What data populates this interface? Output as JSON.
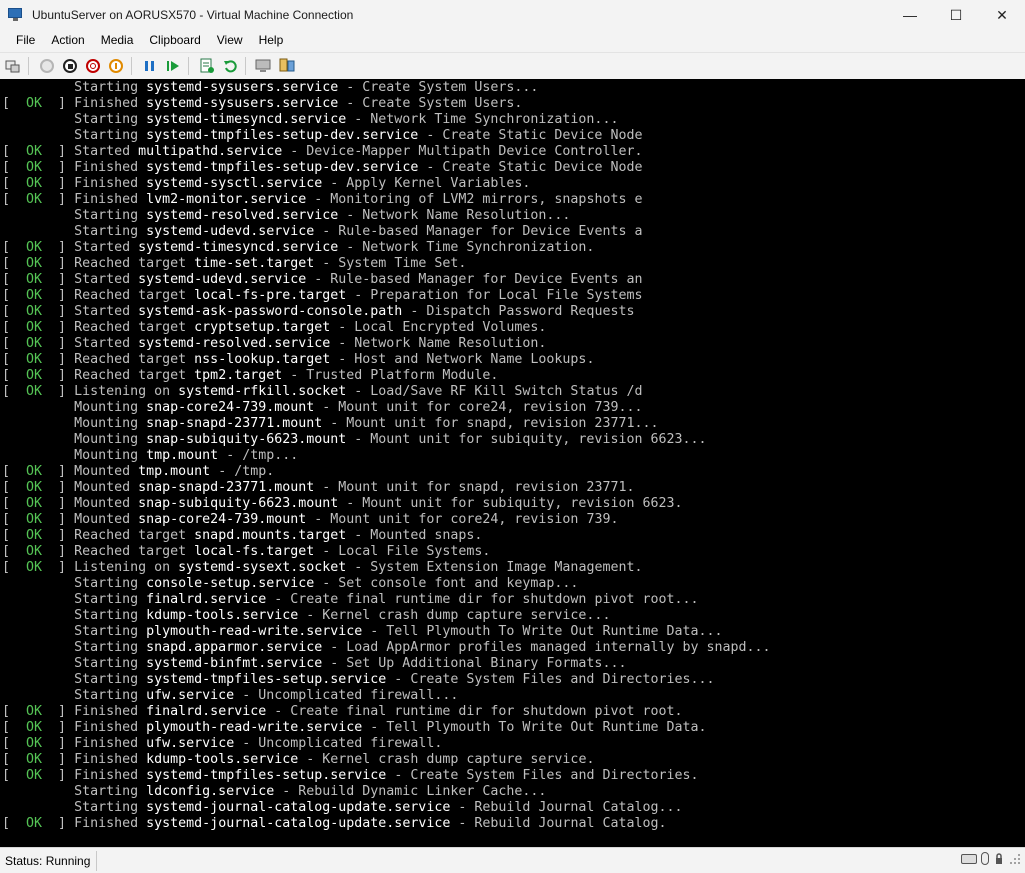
{
  "window": {
    "title": "UbuntuServer on AORUSX570 - Virtual Machine Connection",
    "minimize": "—",
    "maximize": "☐",
    "close": "✕"
  },
  "menu": [
    "File",
    "Action",
    "Media",
    "Clipboard",
    "View",
    "Help"
  ],
  "toolbar_icons": [
    "ctrl-alt-del-icon",
    "start-icon",
    "turn-off-icon",
    "shut-down-icon",
    "save-icon",
    "pause-icon",
    "resume-icon",
    "checkpoint-icon",
    "revert-icon",
    "enhanced-session-icon",
    "share-icon"
  ],
  "status": {
    "text": "Status: Running"
  },
  "console_lines": [
    {
      "ok": false,
      "verb": "Starting",
      "unit": "systemd-sysusers.service",
      "desc": " - Create System Users..."
    },
    {
      "ok": true,
      "verb": "Finished",
      "unit": "systemd-sysusers.service",
      "desc": " - Create System Users."
    },
    {
      "ok": false,
      "verb": "Starting",
      "unit": "systemd-timesyncd.service",
      "desc": " - Network Time Synchronization..."
    },
    {
      "ok": false,
      "verb": "Starting",
      "unit": "systemd-tmpfiles-setup-dev.service",
      "desc": " - Create Static Device Node"
    },
    {
      "ok": true,
      "verb": "Started",
      "unit": "multipathd.service",
      "desc": " - Device-Mapper Multipath Device Controller."
    },
    {
      "ok": true,
      "verb": "Finished",
      "unit": "systemd-tmpfiles-setup-dev.service",
      "desc": " - Create Static Device Node"
    },
    {
      "ok": true,
      "verb": "Finished",
      "unit": "systemd-sysctl.service",
      "desc": " - Apply Kernel Variables."
    },
    {
      "ok": true,
      "verb": "Finished",
      "unit": "lvm2-monitor.service",
      "desc": " - Monitoring of LVM2 mirrors, snapshots e"
    },
    {
      "ok": false,
      "verb": "Starting",
      "unit": "systemd-resolved.service",
      "desc": " - Network Name Resolution..."
    },
    {
      "ok": false,
      "verb": "Starting",
      "unit": "systemd-udevd.service",
      "desc": " - Rule-based Manager for Device Events a"
    },
    {
      "ok": true,
      "verb": "Started",
      "unit": "systemd-timesyncd.service",
      "desc": " - Network Time Synchronization."
    },
    {
      "ok": true,
      "verb": "Reached target",
      "unit": "time-set.target",
      "desc": " - System Time Set."
    },
    {
      "ok": true,
      "verb": "Started",
      "unit": "systemd-udevd.service",
      "desc": " - Rule-based Manager for Device Events an"
    },
    {
      "ok": true,
      "verb": "Reached target",
      "unit": "local-fs-pre.target",
      "desc": " - Preparation for Local File Systems"
    },
    {
      "ok": true,
      "verb": "Started",
      "unit": "systemd-ask-password-console.path",
      "desc": " - Dispatch Password Requests"
    },
    {
      "ok": true,
      "verb": "Reached target",
      "unit": "cryptsetup.target",
      "desc": " - Local Encrypted Volumes."
    },
    {
      "ok": true,
      "verb": "Started",
      "unit": "systemd-resolved.service",
      "desc": " - Network Name Resolution."
    },
    {
      "ok": true,
      "verb": "Reached target",
      "unit": "nss-lookup.target",
      "desc": " - Host and Network Name Lookups."
    },
    {
      "ok": true,
      "verb": "Reached target",
      "unit": "tpm2.target",
      "desc": " - Trusted Platform Module."
    },
    {
      "ok": true,
      "verb": "Listening on",
      "unit": "systemd-rfkill.socket",
      "desc": " - Load/Save RF Kill Switch Status /d"
    },
    {
      "ok": false,
      "verb": "Mounting",
      "unit": "snap-core24-739.mount",
      "desc": " - Mount unit for core24, revision 739..."
    },
    {
      "ok": false,
      "verb": "Mounting",
      "unit": "snap-snapd-23771.mount",
      "desc": " - Mount unit for snapd, revision 23771..."
    },
    {
      "ok": false,
      "verb": "Mounting",
      "unit": "snap-subiquity-6623.mount",
      "desc": " - Mount unit for subiquity, revision 6623..."
    },
    {
      "ok": false,
      "verb": "Mounting",
      "unit": "tmp.mount",
      "desc": " - /tmp..."
    },
    {
      "ok": true,
      "verb": "Mounted",
      "unit": "tmp.mount",
      "desc": " - /tmp."
    },
    {
      "ok": true,
      "verb": "Mounted",
      "unit": "snap-snapd-23771.mount",
      "desc": " - Mount unit for snapd, revision 23771."
    },
    {
      "ok": true,
      "verb": "Mounted",
      "unit": "snap-subiquity-6623.mount",
      "desc": " - Mount unit for subiquity, revision 6623."
    },
    {
      "ok": true,
      "verb": "Mounted",
      "unit": "snap-core24-739.mount",
      "desc": " - Mount unit for core24, revision 739."
    },
    {
      "ok": true,
      "verb": "Reached target",
      "unit": "snapd.mounts.target",
      "desc": " - Mounted snaps."
    },
    {
      "ok": true,
      "verb": "Reached target",
      "unit": "local-fs.target",
      "desc": " - Local File Systems."
    },
    {
      "ok": true,
      "verb": "Listening on",
      "unit": "systemd-sysext.socket",
      "desc": " - System Extension Image Management."
    },
    {
      "ok": false,
      "verb": "Starting",
      "unit": "console-setup.service",
      "desc": " - Set console font and keymap..."
    },
    {
      "ok": false,
      "verb": "Starting",
      "unit": "finalrd.service",
      "desc": " - Create final runtime dir for shutdown pivot root..."
    },
    {
      "ok": false,
      "verb": "Starting",
      "unit": "kdump-tools.service",
      "desc": " - Kernel crash dump capture service..."
    },
    {
      "ok": false,
      "verb": "Starting",
      "unit": "plymouth-read-write.service",
      "desc": " - Tell Plymouth To Write Out Runtime Data..."
    },
    {
      "ok": false,
      "verb": "Starting",
      "unit": "snapd.apparmor.service",
      "desc": " - Load AppArmor profiles managed internally by snapd..."
    },
    {
      "ok": false,
      "verb": "Starting",
      "unit": "systemd-binfmt.service",
      "desc": " - Set Up Additional Binary Formats..."
    },
    {
      "ok": false,
      "verb": "Starting",
      "unit": "systemd-tmpfiles-setup.service",
      "desc": " - Create System Files and Directories..."
    },
    {
      "ok": false,
      "verb": "Starting",
      "unit": "ufw.service",
      "desc": " - Uncomplicated firewall..."
    },
    {
      "ok": true,
      "verb": "Finished",
      "unit": "finalrd.service",
      "desc": " - Create final runtime dir for shutdown pivot root."
    },
    {
      "ok": true,
      "verb": "Finished",
      "unit": "plymouth-read-write.service",
      "desc": " - Tell Plymouth To Write Out Runtime Data."
    },
    {
      "ok": true,
      "verb": "Finished",
      "unit": "ufw.service",
      "desc": " - Uncomplicated firewall."
    },
    {
      "ok": true,
      "verb": "Finished",
      "unit": "kdump-tools.service",
      "desc": " - Kernel crash dump capture service."
    },
    {
      "ok": true,
      "verb": "Finished",
      "unit": "systemd-tmpfiles-setup.service",
      "desc": " - Create System Files and Directories."
    },
    {
      "ok": false,
      "verb": "Starting",
      "unit": "ldconfig.service",
      "desc": " - Rebuild Dynamic Linker Cache..."
    },
    {
      "ok": false,
      "verb": "Starting",
      "unit": "systemd-journal-catalog-update.service",
      "desc": " - Rebuild Journal Catalog..."
    },
    {
      "ok": true,
      "verb": "Finished",
      "unit": "systemd-journal-catalog-update.service",
      "desc": " - Rebuild Journal Catalog."
    }
  ],
  "ok_label": "OK"
}
